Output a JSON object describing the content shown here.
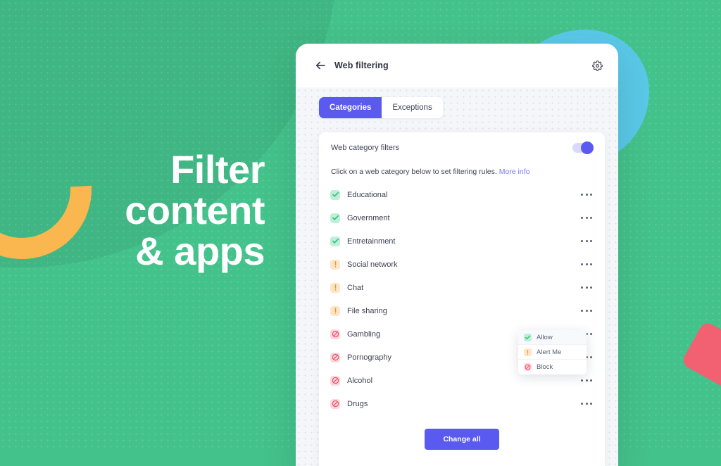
{
  "marketing": {
    "headline_lines": [
      "Filter",
      "content",
      "& apps"
    ],
    "colors": {
      "background_green": "#44c28c",
      "blob_dark_green": "#3fb683",
      "arc_orange": "#fab74f",
      "blob_blue": "#5ac8e8",
      "square_red": "#f26172",
      "headline_text": "#ffffff"
    }
  },
  "app": {
    "appbar": {
      "back_icon": "arrow-left-icon",
      "title": "Web filtering",
      "settings_icon": "gear-icon"
    },
    "tabs": [
      {
        "label": "Categories",
        "active": true
      },
      {
        "label": "Exceptions",
        "active": false
      }
    ],
    "panel": {
      "toggle_label": "Web category filters",
      "toggle_on": true,
      "hint_text": "Click on a web category below to set filtering rules.",
      "hint_link": "More info",
      "row_menu_icon": "more-horizontal-icon",
      "categories": [
        {
          "label": "Educational",
          "status": "allow",
          "status_icon": "check-icon"
        },
        {
          "label": "Government",
          "status": "allow",
          "status_icon": "check-icon"
        },
        {
          "label": "Entretainment",
          "status": "allow",
          "status_icon": "check-icon"
        },
        {
          "label": "Social network",
          "status": "alert",
          "status_icon": "exclamation-icon"
        },
        {
          "label": "Chat",
          "status": "alert",
          "status_icon": "exclamation-icon"
        },
        {
          "label": "File sharing",
          "status": "alert",
          "status_icon": "exclamation-icon"
        },
        {
          "label": "Gambling",
          "status": "block",
          "status_icon": "prohibited-icon"
        },
        {
          "label": "Pornography",
          "status": "block",
          "status_icon": "prohibited-icon"
        },
        {
          "label": "Alcohol",
          "status": "block",
          "status_icon": "prohibited-icon"
        },
        {
          "label": "Drugs",
          "status": "block",
          "status_icon": "prohibited-icon"
        }
      ],
      "change_all_label": "Change all"
    },
    "context_menu": {
      "open_for_row": "Chat",
      "items": [
        {
          "label": "Allow",
          "status": "allow",
          "status_icon": "check-icon",
          "selected": true
        },
        {
          "label": "Alert Me",
          "status": "alert",
          "status_icon": "exclamation-icon",
          "selected": false
        },
        {
          "label": "Block",
          "status": "block",
          "status_icon": "prohibited-icon",
          "selected": false
        }
      ]
    },
    "colors": {
      "accent_purple": "#5a5af0",
      "allow_green": "#2fb97a",
      "alert_orange": "#f0992f",
      "block_red": "#ef5068"
    }
  }
}
